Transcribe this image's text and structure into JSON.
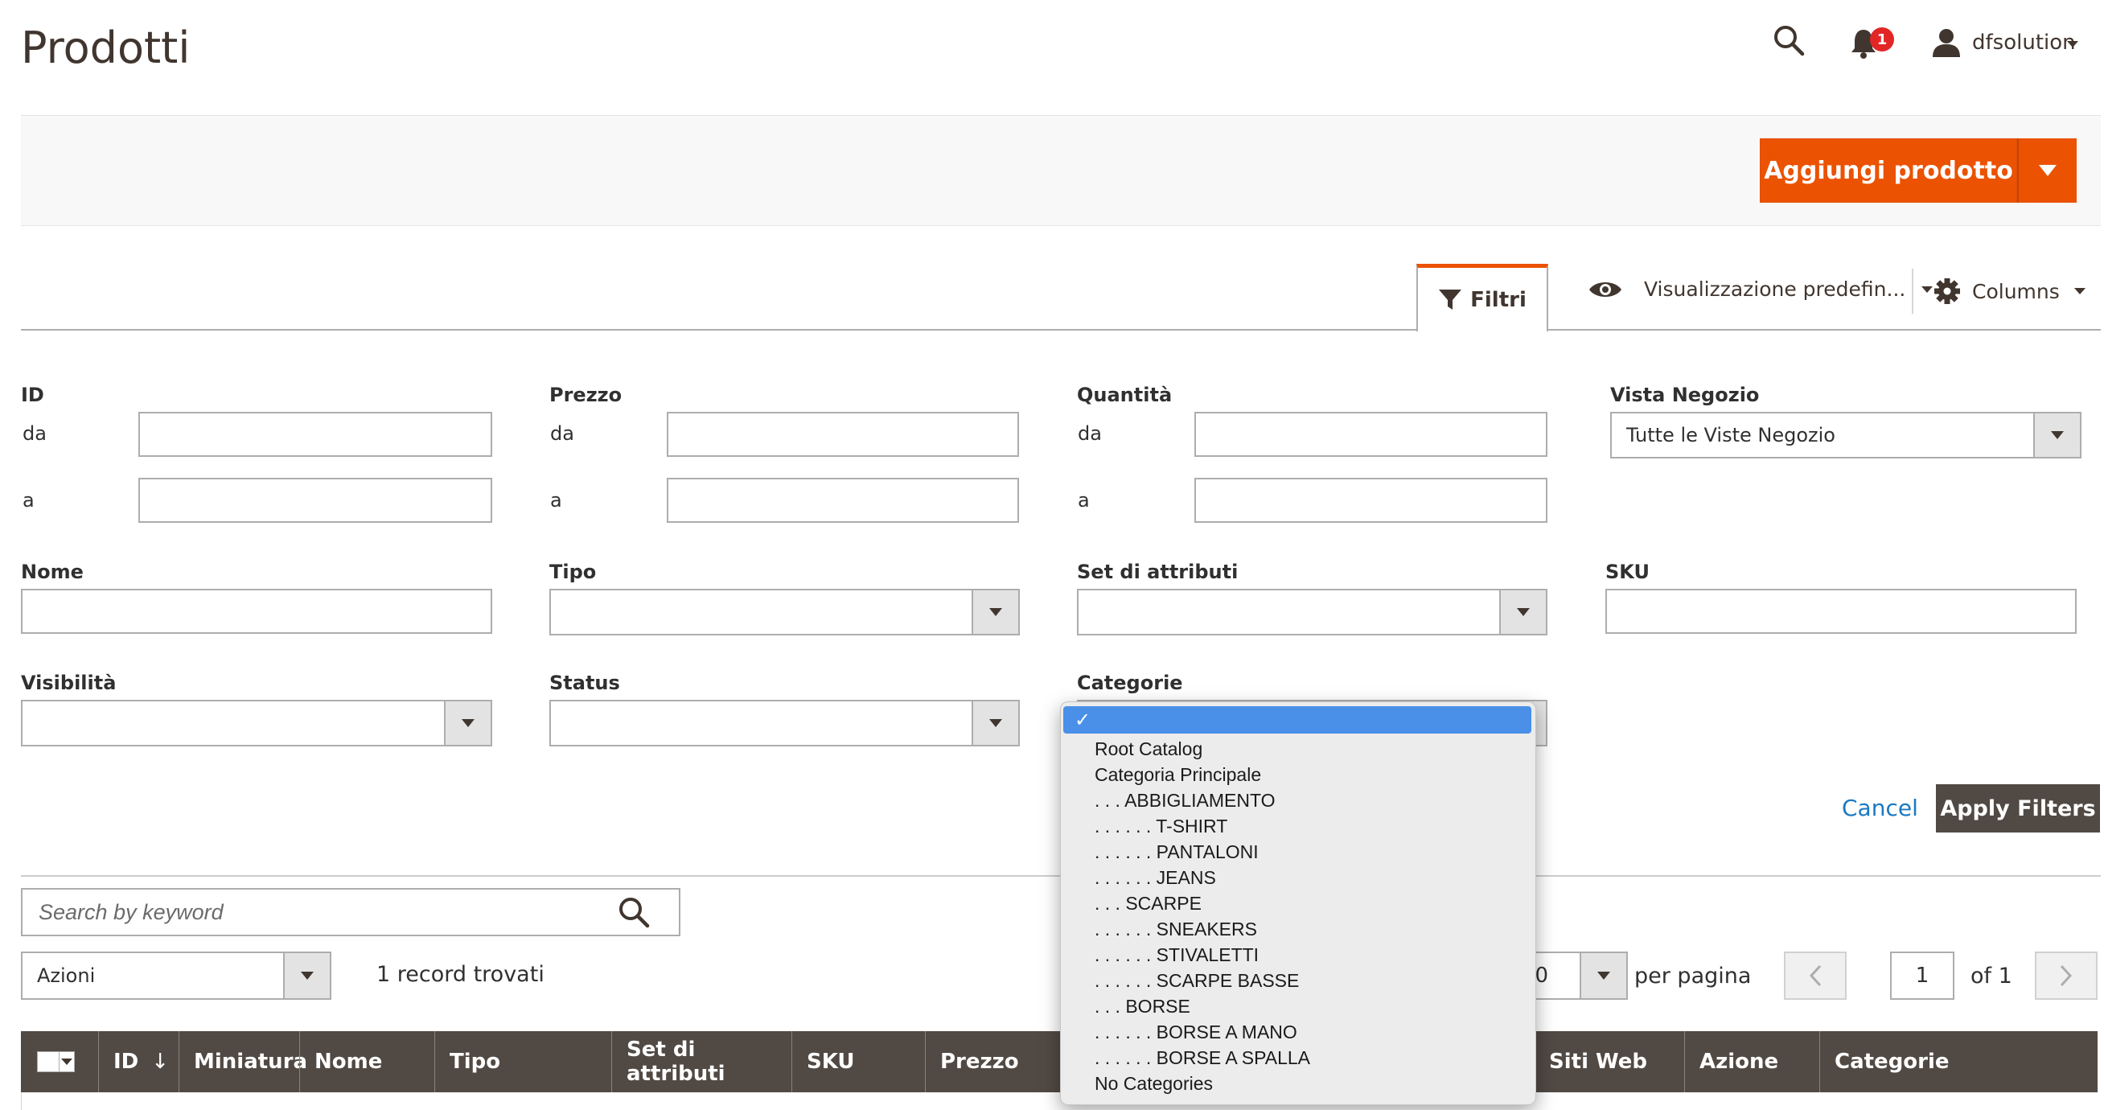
{
  "header": {
    "title": "Prodotti",
    "notification_count": "1",
    "user_name": "dfsolution"
  },
  "actions": {
    "add_product": "Aggiungi prodotto"
  },
  "toolbar": {
    "filters_tab": "Filtri",
    "default_view": "Visualizzazione predefin...",
    "columns": "Columns"
  },
  "filters": {
    "id": {
      "label": "ID",
      "from_label": "da",
      "to_label": "a"
    },
    "price": {
      "label": "Prezzo",
      "from_label": "da",
      "to_label": "a"
    },
    "quantity": {
      "label": "Quantità",
      "from_label": "da",
      "to_label": "a"
    },
    "store_view": {
      "label": "Vista Negozio",
      "value": "Tutte le Viste Negozio"
    },
    "name": {
      "label": "Nome"
    },
    "type": {
      "label": "Tipo"
    },
    "attribute_set": {
      "label": "Set di attributi"
    },
    "sku": {
      "label": "SKU"
    },
    "visibility": {
      "label": "Visibilità"
    },
    "status": {
      "label": "Status"
    },
    "categories": {
      "label": "Categorie"
    },
    "cancel": "Cancel",
    "apply": "Apply Filters"
  },
  "category_dropdown": {
    "selected_mark": "✓",
    "options": [
      "Root Catalog",
      "Categoria Principale",
      ". . . ABBIGLIAMENTO",
      ". . . . . . T-SHIRT",
      ". . . . . . PANTALONI",
      ". . . . . . JEANS",
      ". . . SCARPE",
      ". . . . . . SNEAKERS",
      ". . . . . . STIVALETTI",
      ". . . . . . SCARPE BASSE",
      ". . . BORSE",
      ". . . . . . BORSE A MANO",
      ". . . . . . BORSE A SPALLA",
      "No Categories"
    ]
  },
  "search": {
    "placeholder": "Search by keyword"
  },
  "mass_actions": {
    "label": "Azioni"
  },
  "records_found": "1 record trovati",
  "pagination": {
    "per_page_value": "20",
    "per_page_label": "per pagina",
    "current_page": "1",
    "of_label": "of 1"
  },
  "grid": {
    "columns": [
      "ID",
      "Miniatura",
      "Nome",
      "Tipo",
      "Set di attributi",
      "SKU",
      "Prezzo",
      "Siti Web",
      "Azione",
      "Categorie"
    ]
  },
  "colors": {
    "accent": "#eb5202",
    "header_bg": "#514943",
    "link": "#1979c3",
    "dropdown_highlight": "#4a90e8"
  }
}
